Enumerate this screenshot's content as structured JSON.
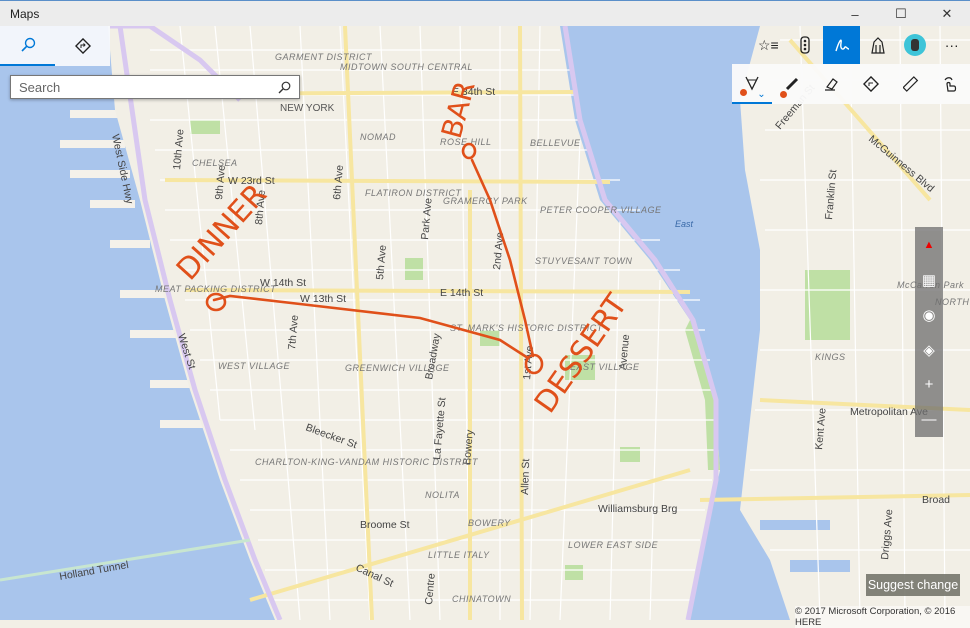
{
  "window": {
    "title": "Maps",
    "minimize": "–",
    "maximize": "☐",
    "close": "✕"
  },
  "left_panel": {
    "tabs": [
      {
        "name": "search",
        "icon": "search-icon",
        "active": true
      },
      {
        "name": "directions",
        "icon": "directions-icon",
        "active": false
      }
    ]
  },
  "search": {
    "placeholder": "Search",
    "value": ""
  },
  "toolbar": {
    "items": [
      {
        "icon": "favorites-icon"
      },
      {
        "icon": "traffic-icon"
      },
      {
        "icon": "windows-ink-icon",
        "active": true
      },
      {
        "icon": "3d-cities-icon"
      },
      {
        "icon": "avatar-icon"
      },
      {
        "icon": "more-icon",
        "label": "···"
      }
    ]
  },
  "ink_toolbar": {
    "items": [
      {
        "icon": "ballpoint-pen-icon",
        "selected": true,
        "color": "#e0501a"
      },
      {
        "icon": "highlighter-icon",
        "color": "#e0501a"
      },
      {
        "icon": "eraser-icon"
      },
      {
        "icon": "directions-icon"
      },
      {
        "icon": "ruler-icon"
      },
      {
        "icon": "touch-writing-icon"
      }
    ]
  },
  "map_controls": [
    {
      "icon": "compass-icon"
    },
    {
      "icon": "tilt-icon"
    },
    {
      "icon": "locate-icon"
    },
    {
      "icon": "layers-icon"
    },
    {
      "icon": "zoom-in-icon",
      "label": "+"
    },
    {
      "icon": "zoom-out-icon",
      "label": "—"
    }
  ],
  "suggest_change": "Suggest change",
  "copyright": "© 2017 Microsoft Corporation, © 2016 HERE",
  "ink_color": "#e0501a",
  "map_labels": {
    "streets": [
      "E 34th St",
      "W 23rd St",
      "W 14th St",
      "W 13th St",
      "E 14th St",
      "Bleecker St",
      "Broome St",
      "Canal St",
      "Williamsburg Brg",
      "Holland Tunnel",
      "West Side Hwy",
      "West St",
      "10th Ave",
      "9th Ave",
      "8th Ave",
      "7th Ave",
      "6th Ave",
      "5th Ave",
      "Park Ave",
      "2nd Ave",
      "1st Ave",
      "Avenue",
      "Allen St",
      "Bowery",
      "Broadway",
      "La Fayette St",
      "Centre",
      "McGuinness Blvd",
      "Franklin St",
      "Freeman St",
      "Metropolitan Ave",
      "Kent Ave",
      "Driggs Ave",
      "Broad",
      "East"
    ],
    "districts": [
      "GARMENT DISTRICT",
      "MIDTOWN SOUTH CENTRAL",
      "NEW YORK",
      "NOMAD",
      "ROSE HILL",
      "BELLEVUE",
      "CHELSEA",
      "FLATIRON DISTRICT",
      "GRAMERCY PARK",
      "PETER COOPER VILLAGE",
      "STUYVESANT TOWN",
      "MEAT PACKING DISTRICT",
      "ST. MARK'S HISTORIC DISTRICT",
      "EAST VILLAGE",
      "WEST VILLAGE",
      "GREENWICH VILLAGE",
      "CHARLTON-KING-VANDAM HISTORIC DISTRICT",
      "NOLITA",
      "BOWERY",
      "LITTLE ITALY",
      "LOWER EAST SIDE",
      "CHINATOWN",
      "KINGS",
      "McCarren Park",
      "NORTH"
    ]
  },
  "ink_annotations": [
    "DINNER",
    "BAR",
    "DESSERT"
  ]
}
